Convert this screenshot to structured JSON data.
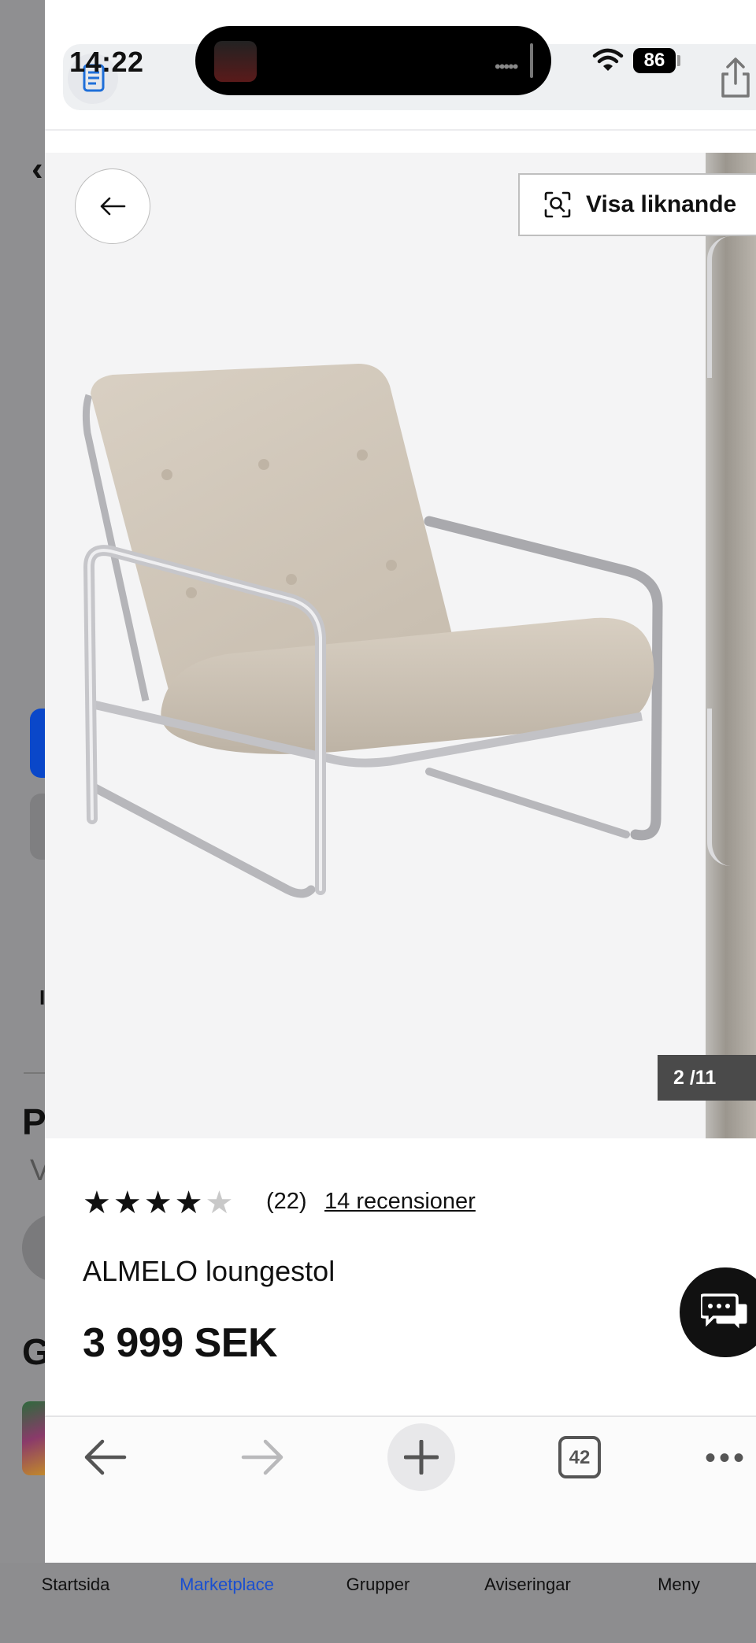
{
  "status_bar": {
    "time": "14:22",
    "battery": "86"
  },
  "page": {
    "similar_button": "Visa liknande",
    "image_counter": "2 /11",
    "rating": {
      "stars_filled": 4,
      "stars_total": 5,
      "count": "(22)",
      "reviews_link": "14 recensioner"
    },
    "product_name": "ALMELO loungestol",
    "price": "3 999 SEK"
  },
  "browser_toolbar": {
    "tab_count": "42"
  },
  "background_app": {
    "letters": {
      "p": "P",
      "v": "V",
      "g": "G",
      "small": "I"
    },
    "tabs": [
      "Startsida",
      "Marketplace",
      "Grupper",
      "Aviseringar",
      "Meny"
    ],
    "active_tab_color": "#1a4fd0"
  },
  "icons": [
    "reader-icon",
    "share-icon",
    "wifi-icon",
    "back-arrow-icon",
    "visual-search-icon",
    "star-icon",
    "chat-icon",
    "nav-back-icon",
    "nav-forward-icon",
    "new-tab-plus-icon",
    "tabs-icon",
    "more-icon"
  ]
}
